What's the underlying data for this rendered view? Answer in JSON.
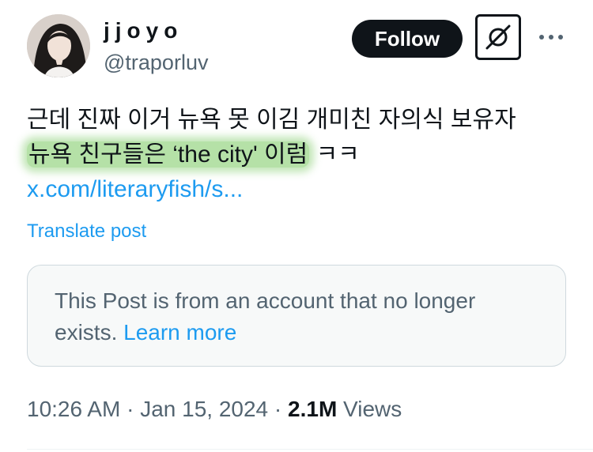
{
  "author": {
    "display_name": "jjoyo",
    "handle": "@traporluv"
  },
  "actions": {
    "follow_label": "Follow"
  },
  "icons": {
    "avatar": "profile-photo",
    "grok": "grok-icon",
    "more": "more-dots-icon"
  },
  "tweet": {
    "line1": "근데 진짜 이거 뉴욕 못 이김 개미친 자의식 보유자",
    "highlighted": "뉴욕 친구들은 ‘the city' 이럼",
    "after_highlight": " ㅋㅋ",
    "link_text": "x.com/literaryfish/s...",
    "translate_label": "Translate post"
  },
  "notice": {
    "text": "This Post is from an account that no longer exists.",
    "link_label": "Learn more"
  },
  "meta": {
    "time": "10:26 AM",
    "separator": "·",
    "date": "Jan 15, 2024",
    "views_count": "2.1M",
    "views_label": "Views"
  },
  "colors": {
    "accent": "#1d9bf0",
    "text": "#0f1419",
    "secondary": "#536471",
    "highlight": "#8fd07a"
  }
}
